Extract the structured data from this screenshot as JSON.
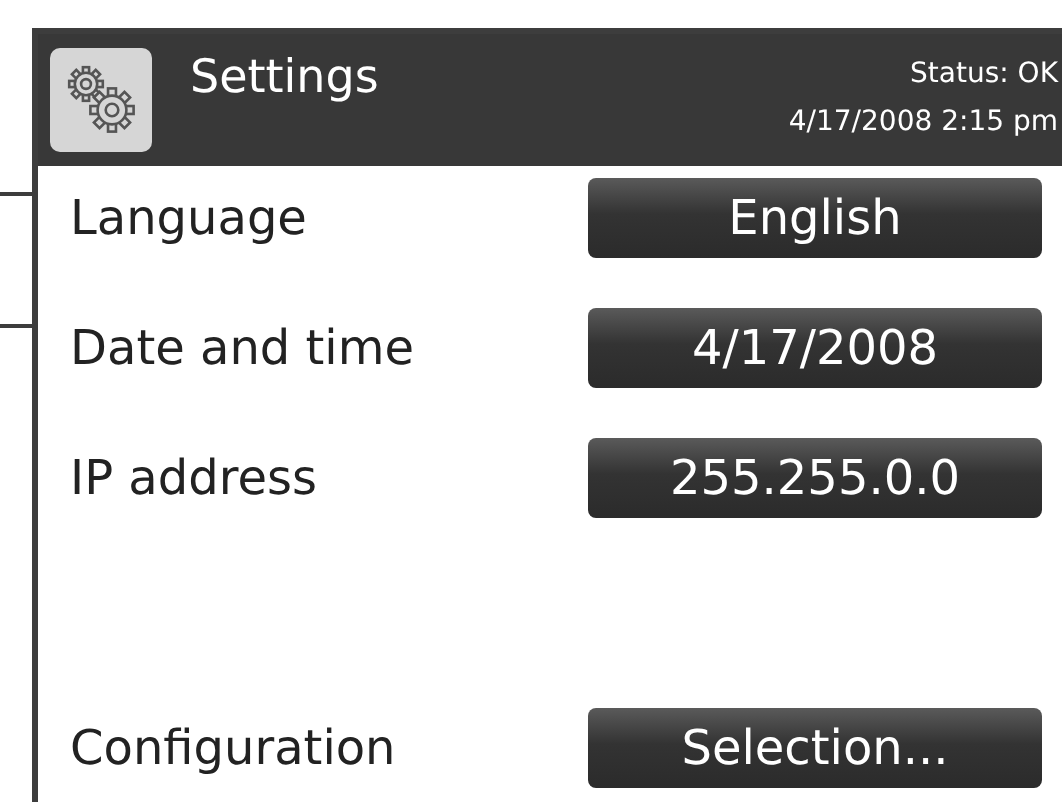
{
  "header": {
    "title": "Settings",
    "status": "Status: OK",
    "datetime": "4/17/2008 2:15 pm"
  },
  "rows": [
    {
      "label": "Language",
      "value": "English"
    },
    {
      "label": "Date and time",
      "value": "4/17/2008"
    },
    {
      "label": "IP address",
      "value": "255.255.0.0"
    },
    {
      "label": "Configuration",
      "value": "Selection..."
    }
  ]
}
